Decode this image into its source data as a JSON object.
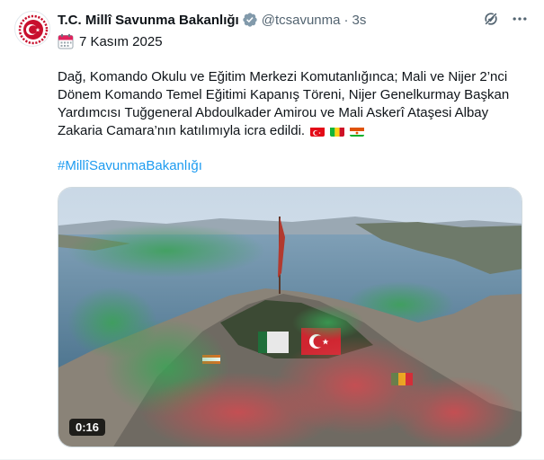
{
  "tweet": {
    "author": {
      "display_name": "T.C. Millî Savunma Bakanlığı",
      "handle": "@tcsavunma",
      "separator": "·",
      "time": "3s",
      "verified_icon": "verified-badge-icon"
    },
    "date_text": "7 Kasım 2025",
    "date_icon": "calendar-icon",
    "body_lines": [
      "Dağ, Komando Okulu ve Eğitim Merkezi Komutanlığınca; Mali ve Nijer 2’nci",
      "Dönem Komando Temel Eğitimi Kapanış Töreni, Nijer Genelkurmay Başkan",
      "Yardımcısı Tuğgeneral Abdoulkader Amirou ve Mali Askerî Ataşesi Albay",
      "Zakaria Camara’nın katılımıyla icra edildi."
    ],
    "flags": [
      "turkey-flag",
      "mali-flag",
      "niger-flag"
    ],
    "hashtag": "#MillîSavunmaBakanlığı",
    "media": {
      "type": "video",
      "duration": "0:16"
    },
    "actions": [
      "grok-icon",
      "more-icon"
    ]
  },
  "colors": {
    "accent": "#1d9bf0",
    "secondary_text": "#536471",
    "verified_gray": "#829aab"
  }
}
